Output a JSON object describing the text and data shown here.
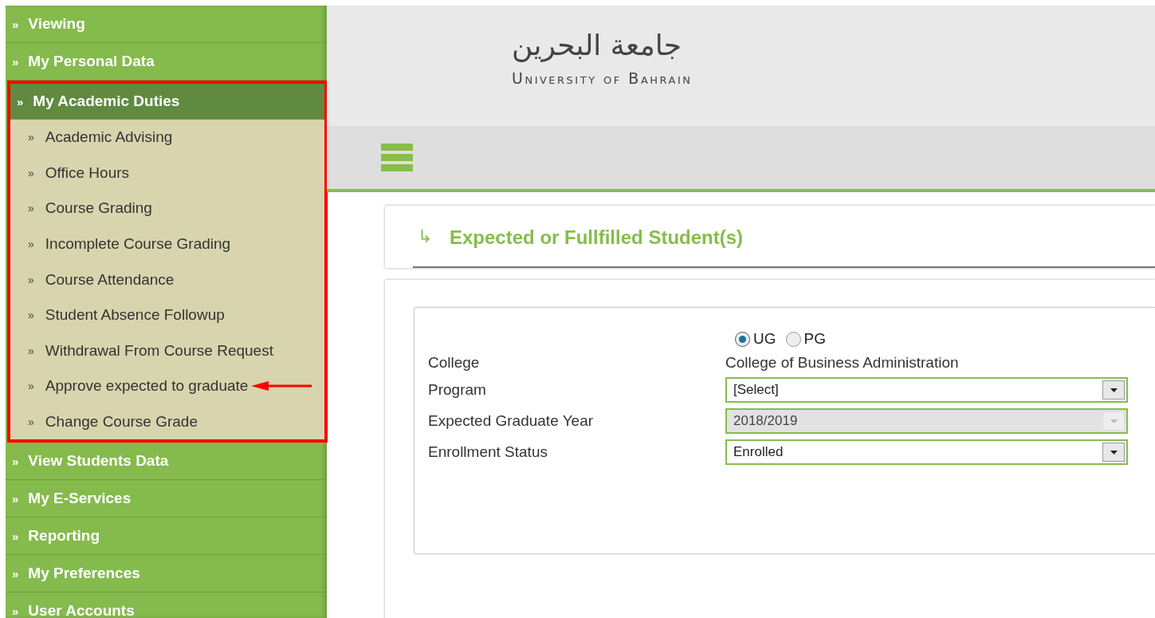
{
  "sidebar": {
    "items": [
      {
        "marker": "»",
        "label": "Viewing",
        "expanded": false,
        "annotated": false
      },
      {
        "marker": "»",
        "label": "My Personal Data",
        "expanded": false,
        "annotated": false
      },
      {
        "marker": "»",
        "label": "My Academic Duties",
        "expanded": true,
        "annotated": true,
        "children": [
          {
            "marker": "»",
            "label": "Academic Advising",
            "pointed": false
          },
          {
            "marker": "»",
            "label": "Office Hours",
            "pointed": false
          },
          {
            "marker": "»",
            "label": "Course Grading",
            "pointed": false
          },
          {
            "marker": "»",
            "label": "Incomplete Course Grading",
            "pointed": false
          },
          {
            "marker": "»",
            "label": "Course Attendance",
            "pointed": false
          },
          {
            "marker": "»",
            "label": "Student Absence Followup",
            "pointed": false
          },
          {
            "marker": "»",
            "label": "Withdrawal From Course Request",
            "pointed": false
          },
          {
            "marker": "»",
            "label": "Approve expected to graduate",
            "pointed": true
          },
          {
            "marker": "»",
            "label": "Change Course Grade",
            "pointed": false
          }
        ]
      },
      {
        "marker": "»",
        "label": "View Students Data",
        "expanded": false,
        "annotated": false
      },
      {
        "marker": "»",
        "label": "My E-Services",
        "expanded": false,
        "annotated": false
      },
      {
        "marker": "»",
        "label": "Reporting",
        "expanded": false,
        "annotated": false
      },
      {
        "marker": "»",
        "label": "My Preferences",
        "expanded": false,
        "annotated": false
      },
      {
        "marker": "»",
        "label": "User Accounts",
        "expanded": false,
        "annotated": false
      }
    ]
  },
  "header": {
    "logo_arabic": "جامعة البحرين",
    "logo_english": "University of Bahrain"
  },
  "page": {
    "icon": "↳",
    "title": "Expected or Fullfilled Student(s)"
  },
  "form": {
    "level_options": [
      {
        "label": "UG",
        "selected": true
      },
      {
        "label": "PG",
        "selected": false
      }
    ],
    "fields": [
      {
        "label": "College",
        "kind": "text",
        "value": "College of Business Administration"
      },
      {
        "label": "Program",
        "kind": "select",
        "value": "[Select]",
        "disabled": false
      },
      {
        "label": "Expected Graduate Year",
        "kind": "select",
        "value": "2018/2019",
        "disabled": true
      },
      {
        "label": "Enrollment Status",
        "kind": "select",
        "value": "Enrolled",
        "disabled": false
      }
    ]
  }
}
